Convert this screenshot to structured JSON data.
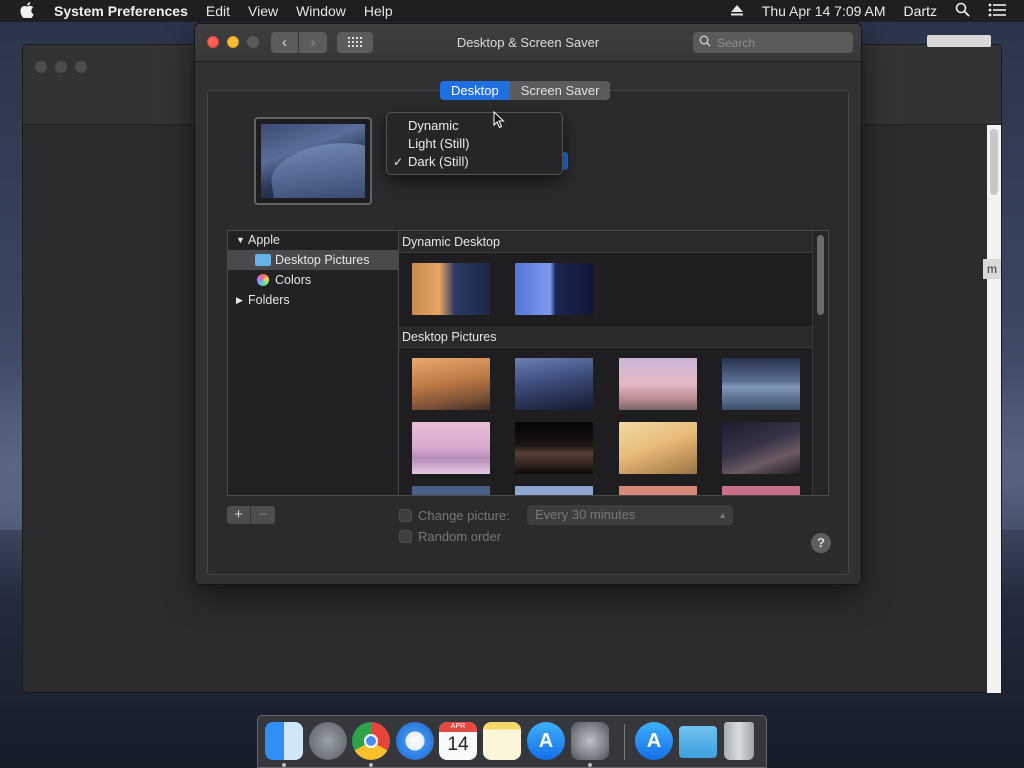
{
  "menubar": {
    "app_name": "System Preferences",
    "menus": [
      "Edit",
      "View",
      "Window",
      "Help"
    ],
    "clock": "Thu Apr 14  7:09 AM",
    "user": "Dartz",
    "icons": [
      "apple-icon",
      "eject-icon",
      "spotlight-search-icon",
      "notification-center-icon"
    ]
  },
  "window": {
    "title": "Desktop & Screen Saver",
    "search_placeholder": "Search",
    "nav_back": "‹",
    "nav_forward": "›"
  },
  "tabs": [
    {
      "label": "Desktop",
      "selected": true
    },
    {
      "label": "Screen Saver",
      "selected": false
    }
  ],
  "appearance_menu": {
    "options": [
      {
        "label": "Dynamic",
        "checked": false
      },
      {
        "label": "Light (Still)",
        "checked": false
      },
      {
        "label": "Dark (Still)",
        "checked": true
      }
    ],
    "check_glyph": "✓"
  },
  "source_list": {
    "apple": "Apple",
    "desktop_pictures": "Desktop Pictures",
    "colors": "Colors",
    "folders": "Folders"
  },
  "sections": {
    "dynamic": "Dynamic Desktop",
    "pictures": "Desktop Pictures"
  },
  "controls": {
    "add": "+",
    "remove": "−",
    "change_picture": "Change picture:",
    "interval": "Every 30 minutes",
    "random_order": "Random order",
    "help": "?"
  },
  "dock": {
    "apps": [
      "finder",
      "launchpad",
      "chrome",
      "safari",
      "calendar",
      "notes",
      "app-store",
      "system-preferences",
      "app-store-downloads",
      "downloads-folder",
      "trash"
    ],
    "calendar_day": "14",
    "calendar_month": "APR"
  },
  "colors": {
    "accent": "#1f6fe0",
    "window_bg": "#313133",
    "menubar_bg": "#1f1f21"
  }
}
